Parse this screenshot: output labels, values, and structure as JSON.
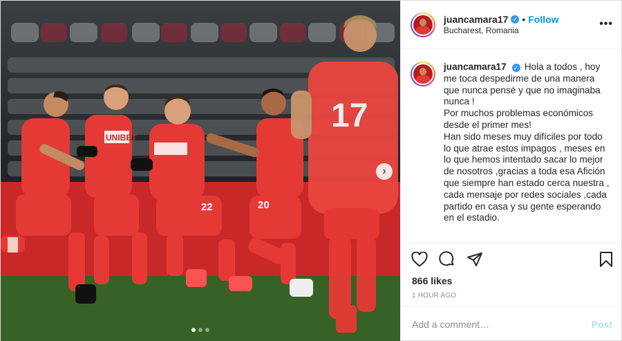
{
  "post": {
    "username": "juancamara17",
    "location": "Bucharest, Romania",
    "follow_label": "Follow",
    "separator": "•",
    "more_icon": "more-dots-icon",
    "caption": "Hola a todos , hoy me toca despedirme de una manera que nunca pensé y que no imaginaba nunca !\nPor muchos problemas económicos desde el primer mes!\nHan sido meses muy difíciles por todo lo que atrae estos impagos , meses en lo que hemos intentado sacar lo mejor de nosotros ,gracias a toda esa Afición que siempre han estado cerca nuestra , cada mensaje por redes sociales ,cada partido en casa y su gente esperando en el estadio.",
    "likes": "866 likes",
    "time": "1 HOUR AGO",
    "comment_placeholder": "Add a comment…",
    "post_label": "Post",
    "carousel": {
      "count": 3,
      "active": 1
    },
    "photo_text": {
      "unibet": "UNIBET",
      "number_17": "17",
      "number_22": "22",
      "number_20": "20"
    }
  },
  "colors": {
    "accent": "#0095f6",
    "verified": "#3897f0",
    "kit_red": "#e53935",
    "pitch": "#3f6b2a"
  },
  "icons": [
    "verified-badge-icon",
    "heart-icon",
    "comment-icon",
    "share-icon",
    "bookmark-icon",
    "chevron-right-icon"
  ]
}
